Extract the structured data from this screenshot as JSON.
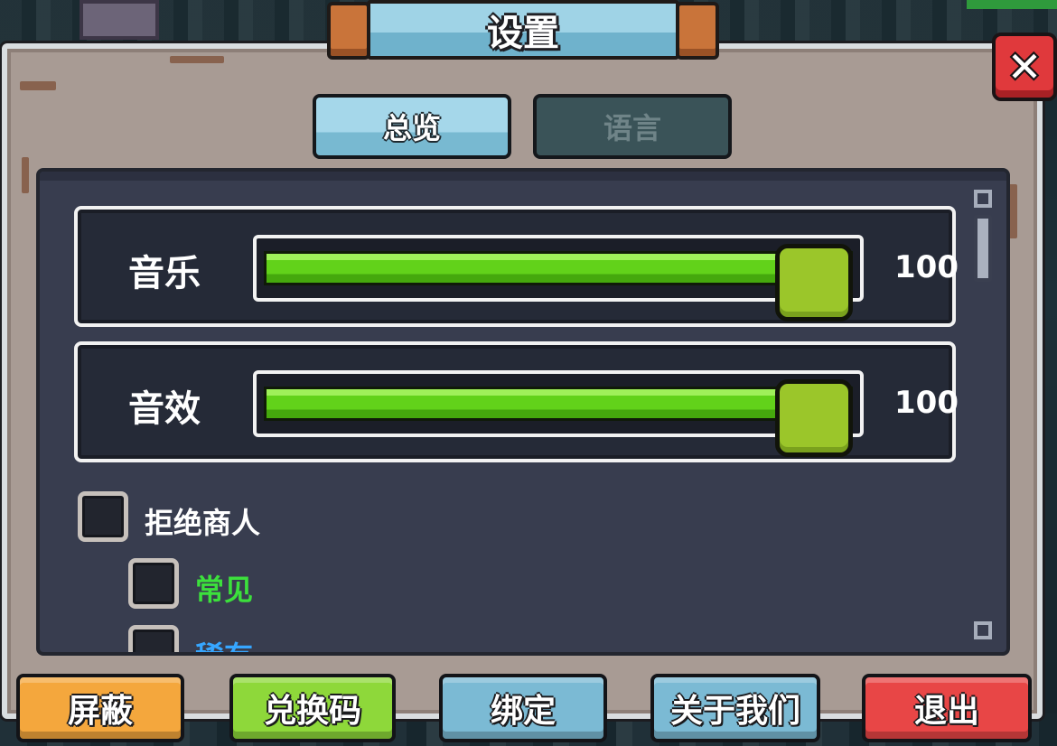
{
  "title": "设置",
  "tabs": [
    {
      "label": "总览",
      "active": true
    },
    {
      "label": "语言",
      "active": false
    }
  ],
  "sliders": [
    {
      "label": "音乐",
      "value": 100,
      "value_text": "100",
      "max": 100
    },
    {
      "label": "音效",
      "value": 100,
      "value_text": "100",
      "max": 100
    }
  ],
  "checkboxes": [
    {
      "label": "拒绝商人",
      "checked": false,
      "color": "#ffffff"
    },
    {
      "label": "常见",
      "checked": false,
      "color": "#3ce03c"
    },
    {
      "label": "稀有",
      "checked": false,
      "color": "#36a6ff"
    }
  ],
  "bottom_buttons": [
    {
      "label": "屏蔽",
      "color": "#f4a73d"
    },
    {
      "label": "兑换码",
      "color": "#8ed83a"
    },
    {
      "label": "绑定",
      "color": "#7bbad4"
    },
    {
      "label": "关于我们",
      "color": "#7bbad4"
    },
    {
      "label": "退出",
      "color": "#e84646"
    }
  ],
  "close_icon": "close-icon",
  "colors": {
    "panel_frame": "#a89b94",
    "content_bg": "#383d4f",
    "slider_fill": "#62d21a",
    "slider_knob": "#9bc62a"
  }
}
